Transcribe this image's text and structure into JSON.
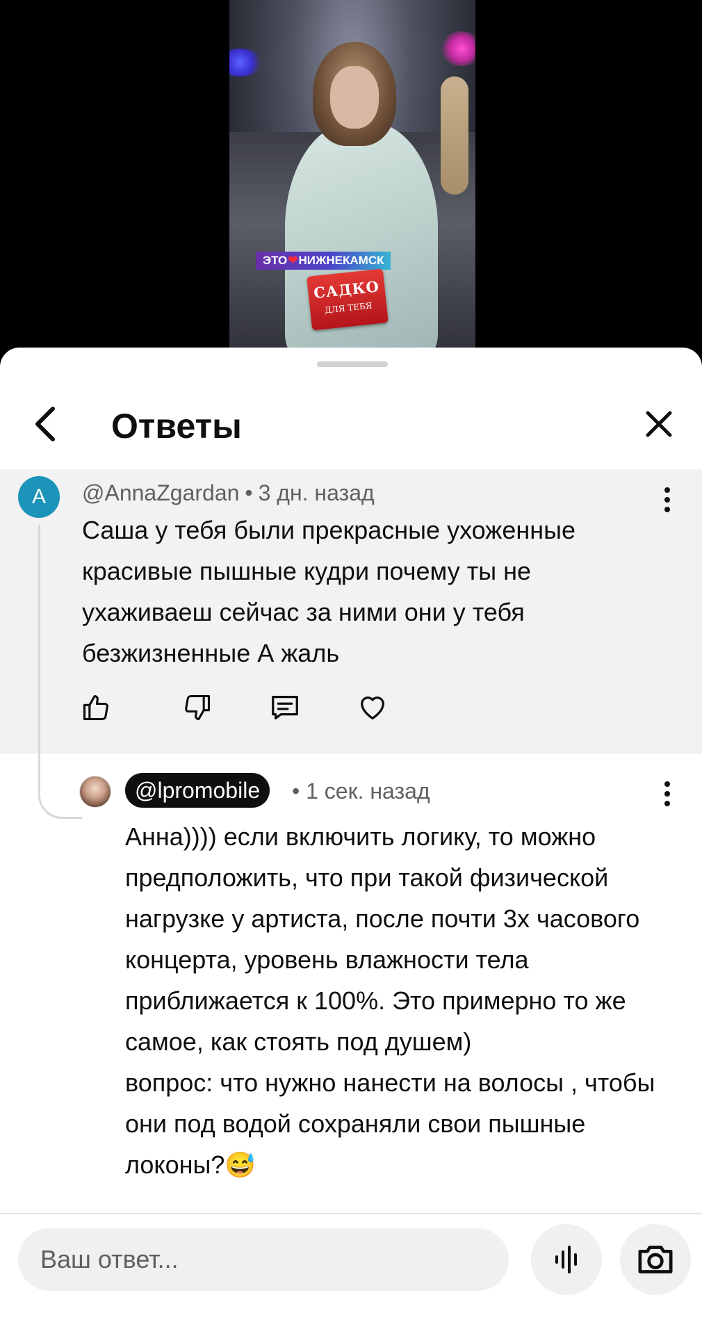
{
  "video": {
    "overlay_text_left": "ЭТО",
    "overlay_text_right": "НИЖНЕКАМСК",
    "badge_title": "САДКО",
    "badge_subtitle": "ДЛЯ ТЕБЯ"
  },
  "header": {
    "title": "Ответы",
    "back_icon": "chevron-left-icon",
    "close_icon": "close-icon"
  },
  "parent_comment": {
    "avatar_letter": "A",
    "avatar_color": "#1c93b8",
    "author": "@AnnaZgardan",
    "time": "3 дн. назад",
    "text": "Саша у тебя были прекрасные ухоженные красивые пышные кудри почему ты не ухаживаеш сейчас за ними они у тебя безжизненные А жаль",
    "actions": [
      "thumbs-up-icon",
      "thumbs-down-icon",
      "reply-icon",
      "heart-icon"
    ]
  },
  "reply": {
    "author": "@lpromobile",
    "time": "1 сек. назад",
    "text": "Анна)))) если включить логику, то можно предположить, что при такой физической нагрузке у артиста, после почти 3х часового концерта, уровень влажности тела приближается к 100%. Это примерно то же самое, как стоять под душем)\nвопрос: что нужно нанести на волосы , чтобы они под водой сохраняли свои пышные локоны?😅"
  },
  "composer": {
    "placeholder": "Ваш ответ...",
    "voice_icon": "voice-wave-icon",
    "camera_icon": "camera-icon"
  },
  "colors": {
    "sheet_bg": "#ffffff",
    "highlight_bg": "#f2f2f2",
    "meta_text": "#606060",
    "chip_bg": "#0f0f0f"
  }
}
